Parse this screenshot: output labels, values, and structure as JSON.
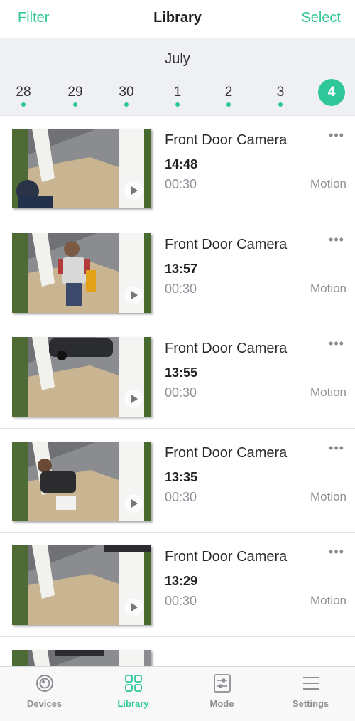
{
  "header": {
    "left_label": "Filter",
    "title": "Library",
    "right_label": "Select"
  },
  "date_strip": {
    "month": "July",
    "days": [
      {
        "label": "28",
        "has_events": true
      },
      {
        "label": "29",
        "has_events": true
      },
      {
        "label": "30",
        "has_events": true
      },
      {
        "label": "1",
        "has_events": true
      },
      {
        "label": "2",
        "has_events": true
      },
      {
        "label": "3",
        "has_events": true
      },
      {
        "label": "4",
        "selected": true
      }
    ]
  },
  "recordings": [
    {
      "camera": "Front Door Camera",
      "time": "14:48",
      "duration": "00:30",
      "trigger": "Motion"
    },
    {
      "camera": "Front Door Camera",
      "time": "13:57",
      "duration": "00:30",
      "trigger": "Motion"
    },
    {
      "camera": "Front Door Camera",
      "time": "13:55",
      "duration": "00:30",
      "trigger": "Motion"
    },
    {
      "camera": "Front Door Camera",
      "time": "13:35",
      "duration": "00:30",
      "trigger": "Motion"
    },
    {
      "camera": "Front Door Camera",
      "time": "13:29",
      "duration": "00:30",
      "trigger": "Motion"
    },
    {
      "camera": "",
      "time": "",
      "duration": "",
      "trigger": ""
    }
  ],
  "more_glyph": "•••",
  "tabbar": {
    "tabs": [
      {
        "label": "Devices",
        "icon": "camera-icon",
        "active": false
      },
      {
        "label": "Library",
        "icon": "grid-icon",
        "active": true
      },
      {
        "label": "Mode",
        "icon": "sliders-icon",
        "active": false
      },
      {
        "label": "Settings",
        "icon": "menu-icon",
        "active": false
      }
    ]
  },
  "colors": {
    "accent": "#2fc79a",
    "muted": "#8b8e93",
    "strip_bg": "#eef0f3"
  }
}
